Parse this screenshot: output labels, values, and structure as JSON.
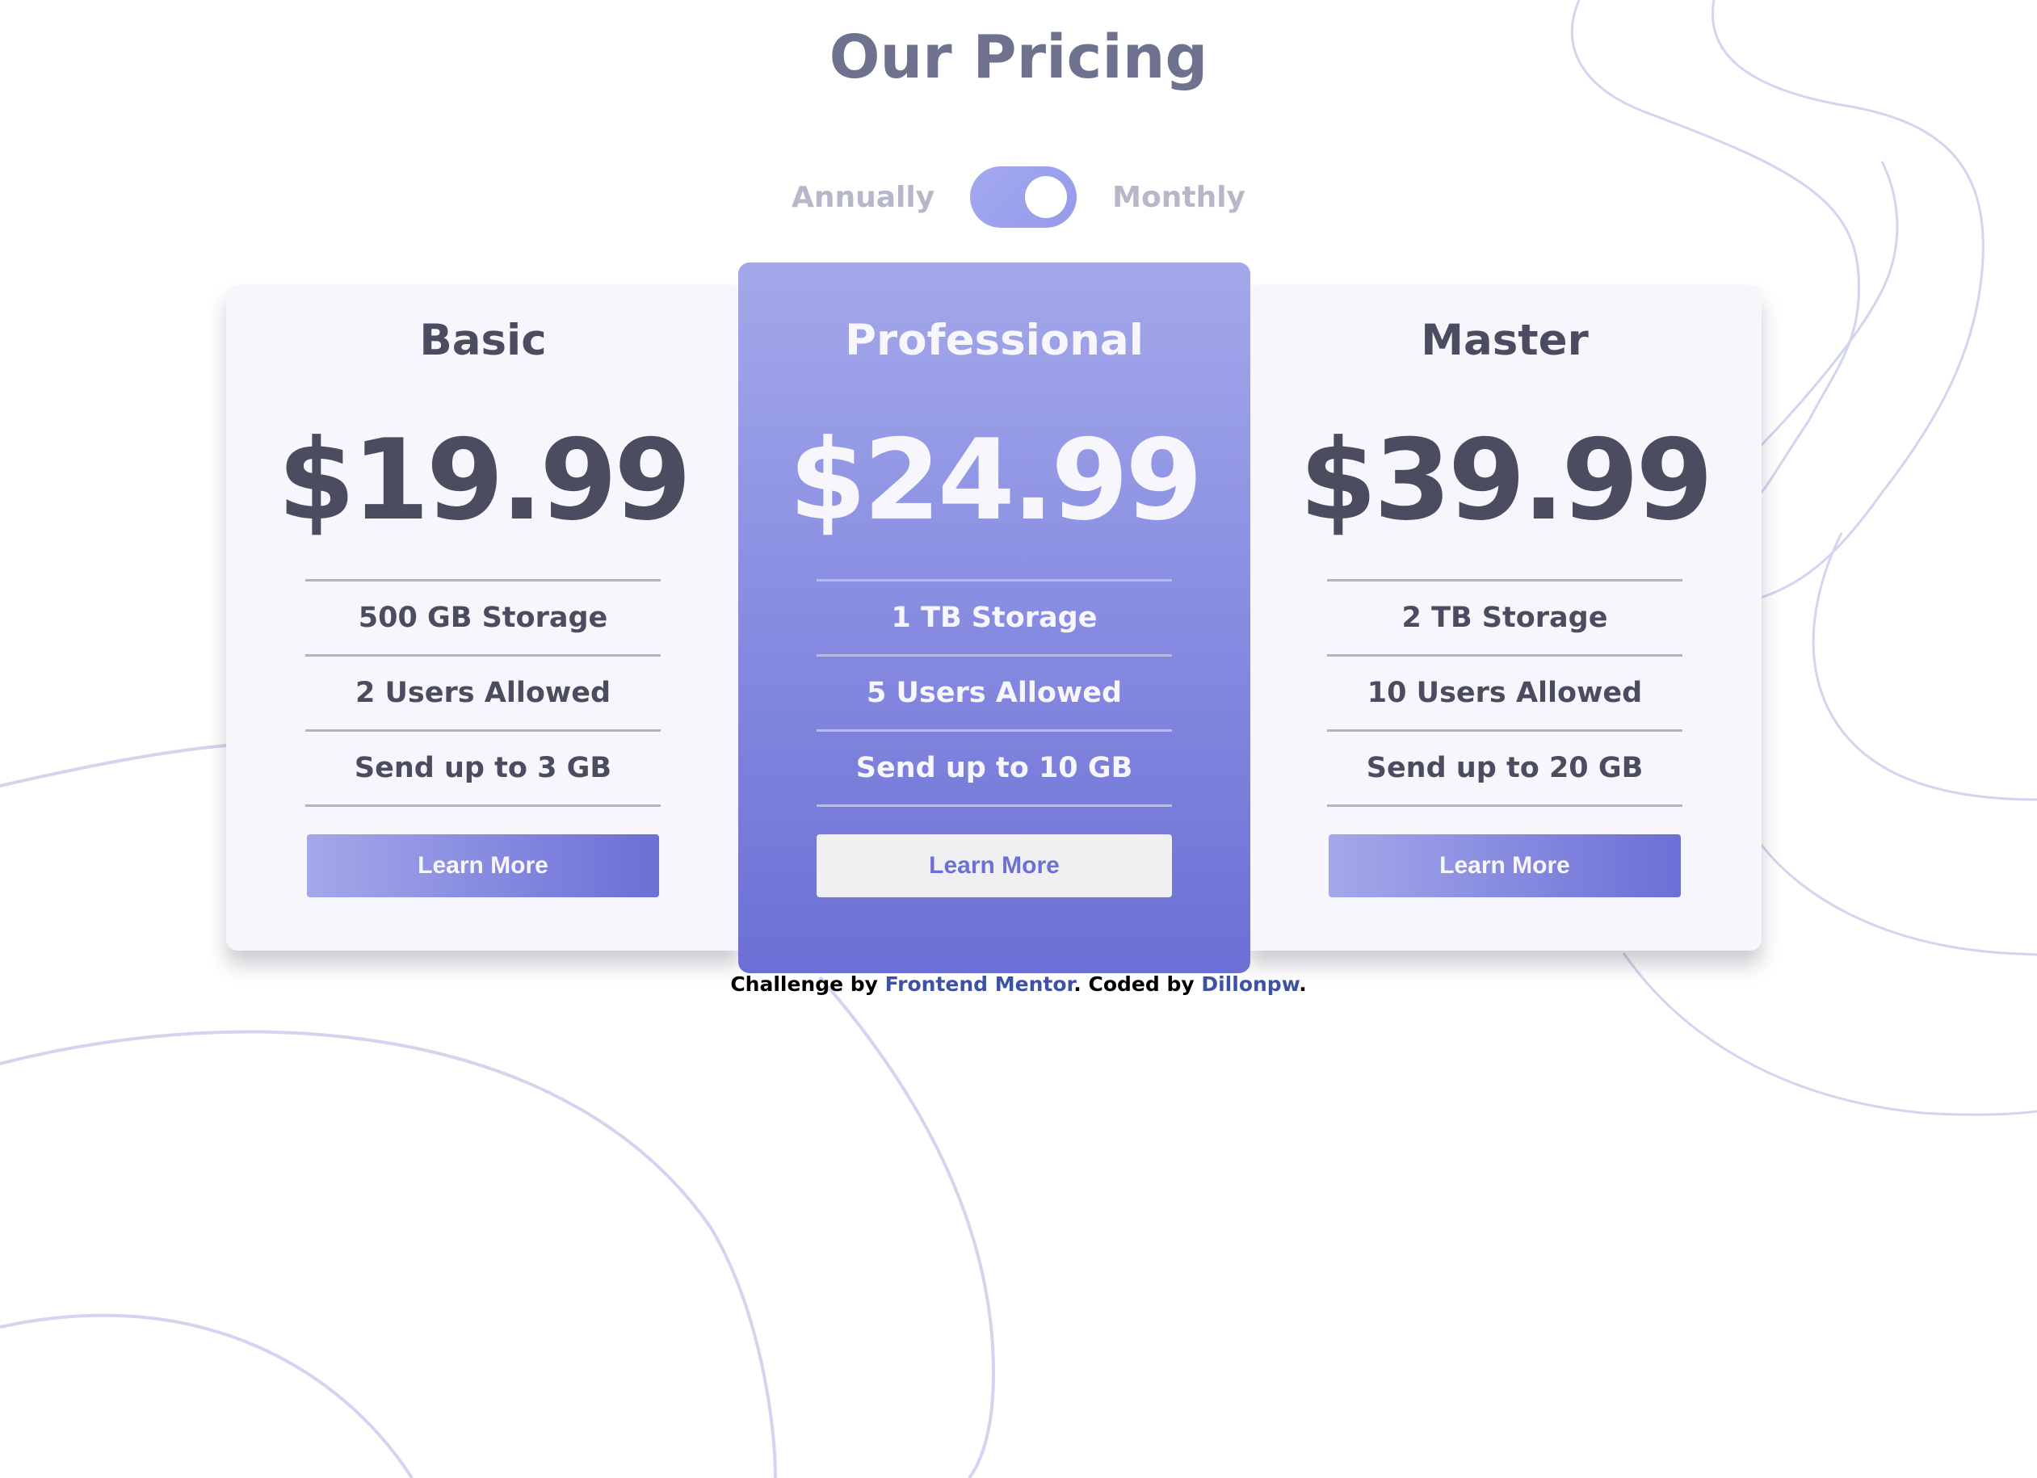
{
  "header": {
    "title": "Our Pricing"
  },
  "billing_toggle": {
    "left_label": "Annually",
    "right_label": "Monthly",
    "state": "monthly"
  },
  "plans": [
    {
      "name": "Basic",
      "price": "$19.99",
      "features": [
        "500 GB Storage",
        "2 Users Allowed",
        "Send up to 3 GB"
      ],
      "button_label": "Learn More"
    },
    {
      "name": "Professional",
      "price": "$24.99",
      "features": [
        "1 TB Storage",
        "5 Users Allowed",
        "Send up to 10 GB"
      ],
      "button_label": "Learn More"
    },
    {
      "name": "Master",
      "price": "$39.99",
      "features": [
        "2 TB Storage",
        "10 Users Allowed",
        "Send up to 20 GB"
      ],
      "button_label": "Learn More"
    }
  ],
  "footer": {
    "prefix": "Challenge by ",
    "mentor_link": "Frontend Mentor",
    "middle": ". Coded by ",
    "author_link": "Dillonpw",
    "suffix": "."
  },
  "colors": {
    "accent_light": "#a3a8f0",
    "accent_dark": "#696fdd",
    "text_dark": "#4b4c60",
    "title_gray": "#6e728e",
    "card_bg": "#f6f6fc",
    "link_blue": "#3e52a3"
  }
}
